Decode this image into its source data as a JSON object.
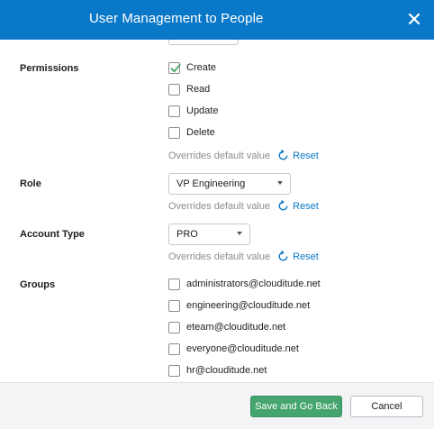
{
  "dialog": {
    "title": "User Management to People",
    "close_icon": "close-icon"
  },
  "permissions": {
    "label": "Permissions",
    "options": [
      {
        "label": "Create",
        "checked": true
      },
      {
        "label": "Read",
        "checked": false
      },
      {
        "label": "Update",
        "checked": false
      },
      {
        "label": "Delete",
        "checked": false
      }
    ],
    "override_text": "Overrides default value",
    "reset_label": "Reset"
  },
  "role": {
    "label": "Role",
    "selected": "VP Engineering",
    "override_text": "Overrides default value",
    "reset_label": "Reset"
  },
  "account_type": {
    "label": "Account Type",
    "selected": "PRO",
    "override_text": "Overrides default value",
    "reset_label": "Reset"
  },
  "groups": {
    "label": "Groups",
    "options": [
      {
        "label": "administrators@clouditude.net",
        "checked": false
      },
      {
        "label": "engineering@clouditude.net",
        "checked": false
      },
      {
        "label": "eteam@clouditude.net",
        "checked": false
      },
      {
        "label": "everyone@clouditude.net",
        "checked": false
      },
      {
        "label": "hr@clouditude.net",
        "checked": false
      }
    ]
  },
  "footer": {
    "save_label": "Save and Go Back",
    "cancel_label": "Cancel"
  },
  "colors": {
    "header": "#0a78c8",
    "accent": "#0a78c8",
    "primary_button": "#45a56e",
    "check": "#45a56e"
  }
}
